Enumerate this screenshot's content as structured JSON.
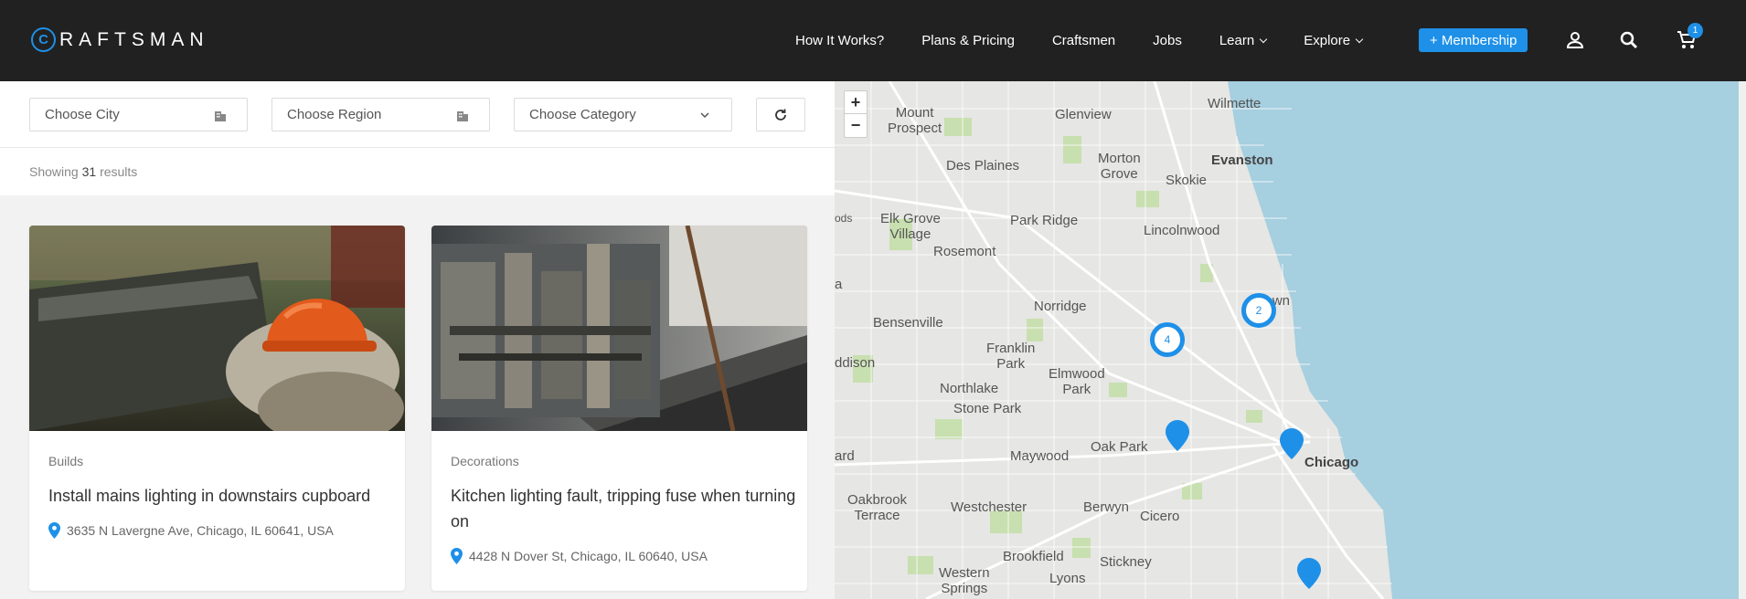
{
  "brand": {
    "logo_letter": "C",
    "logo_rest": "RAFTSMAN",
    "accent": "#1e90e8"
  },
  "nav": {
    "items": [
      "How It Works?",
      "Plans & Pricing",
      "Craftsmen",
      "Jobs",
      "Learn",
      "Explore"
    ],
    "membership": "+ Membership",
    "cart_count": "1"
  },
  "filters": {
    "city": "Choose City",
    "region": "Choose Region",
    "category": "Choose Category"
  },
  "results": {
    "prefix": "Showing",
    "count": "31",
    "suffix": "results"
  },
  "cards": [
    {
      "category": "Builds",
      "title": "Install mains lighting in downstairs cupboard",
      "address": "3635 N Lavergne Ave, Chicago, IL 60641, USA"
    },
    {
      "category": "Decorations",
      "title": "Kitchen lighting fault, tripping fuse when turning on",
      "address": "4428 N Dover St, Chicago, IL 60640, USA"
    }
  ],
  "map": {
    "zoom_in": "+",
    "zoom_out": "−",
    "labels": [
      "Wilmette",
      "Mount\nProspect",
      "Glenview",
      "Des Plaines",
      "Morton\nGrove",
      "Skokie",
      "Evanston",
      "ods",
      "Elk Grove\nVillage",
      "Park Ridge",
      "Lincolnwood",
      "Rosemont",
      "a",
      "Norridge",
      "ptown",
      "Bensenville",
      "Franklin\nPark",
      "ddison",
      "Elmwood\nPark",
      "Northlake",
      "Stone Park",
      "Oak Park",
      "ard",
      "Maywood",
      "Chicago",
      "Oakbrook\nTerrace",
      "Westchester",
      "Berwyn",
      "Cicero",
      "Brookfield",
      "Stickney",
      "Western\nSprings",
      "Lyons"
    ],
    "clusters": [
      "4",
      "2"
    ]
  }
}
